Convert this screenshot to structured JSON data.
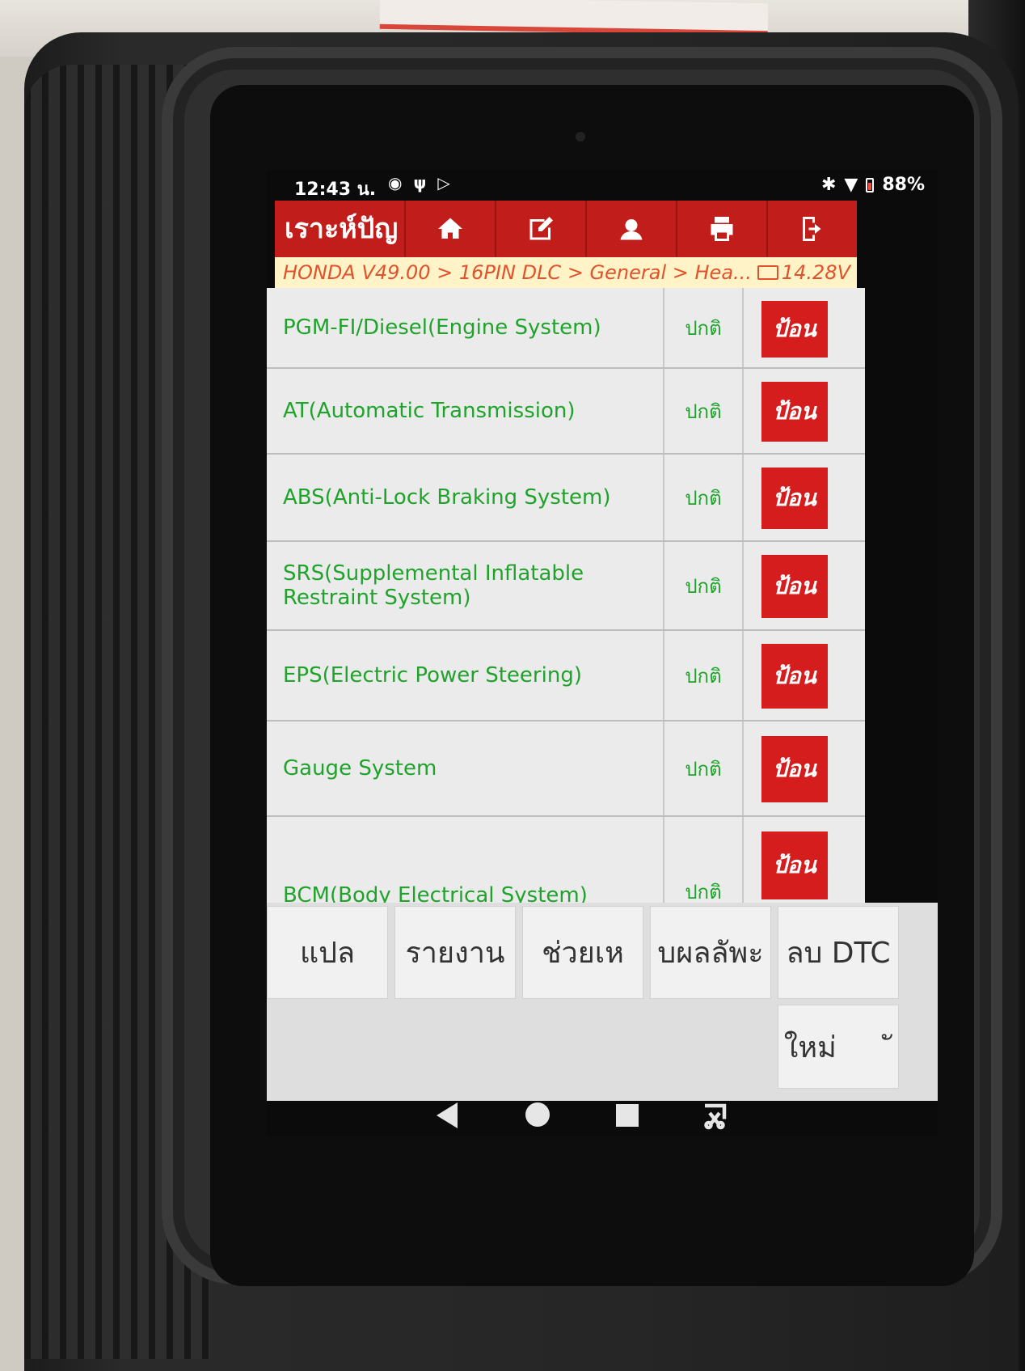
{
  "status_bar": {
    "time": "12:43 น.",
    "battery": "88%",
    "left_icons": [
      "record-icon",
      "usb-icon",
      "play-store-icon"
    ],
    "right_icons": [
      "bluetooth-icon",
      "wifi-icon",
      "battery-icon"
    ]
  },
  "toolbar": {
    "title": "เราะห์ปัญ",
    "buttons": [
      {
        "name": "home-icon"
      },
      {
        "name": "edit-icon"
      },
      {
        "name": "user-icon"
      },
      {
        "name": "print-icon"
      },
      {
        "name": "exit-icon"
      }
    ]
  },
  "breadcrumb": {
    "path": "HONDA V49.00 > 16PIN DLC > General > Hea...",
    "voltage": "14.28V"
  },
  "systems": [
    {
      "name": "PGM-FI/Diesel(Engine System)",
      "status": "ปกติ",
      "action": "ป้อน"
    },
    {
      "name": "AT(Automatic Transmission)",
      "status": "ปกติ",
      "action": "ป้อน"
    },
    {
      "name": "ABS(Anti-Lock Braking System)",
      "status": "ปกติ",
      "action": "ป้อน"
    },
    {
      "name": "SRS(Supplemental Inflatable Restraint System)",
      "status": "ปกติ",
      "action": "ป้อน"
    },
    {
      "name": "EPS(Electric Power Steering)",
      "status": "ปกติ",
      "action": "ป้อน"
    },
    {
      "name": "Gauge System",
      "status": "ปกติ",
      "action": "ป้อน"
    },
    {
      "name": "BCM(Body Electrical System)",
      "status": "ปกติ",
      "action": "ป้อน"
    }
  ],
  "actions": {
    "translate": "แปล",
    "report": "รายงาน",
    "help": "ช่วยเห",
    "results": "บผลลัพะ",
    "clear_dtc": "ลบ DTC",
    "new": "ใหม่      ั"
  },
  "colors": {
    "toolbar": "#c01d1b",
    "system_text": "#1fa32b",
    "enter_button": "#d61d1d",
    "breadcrumb_bg": "#fff3c7",
    "breadcrumb_text": "#e0522a"
  }
}
